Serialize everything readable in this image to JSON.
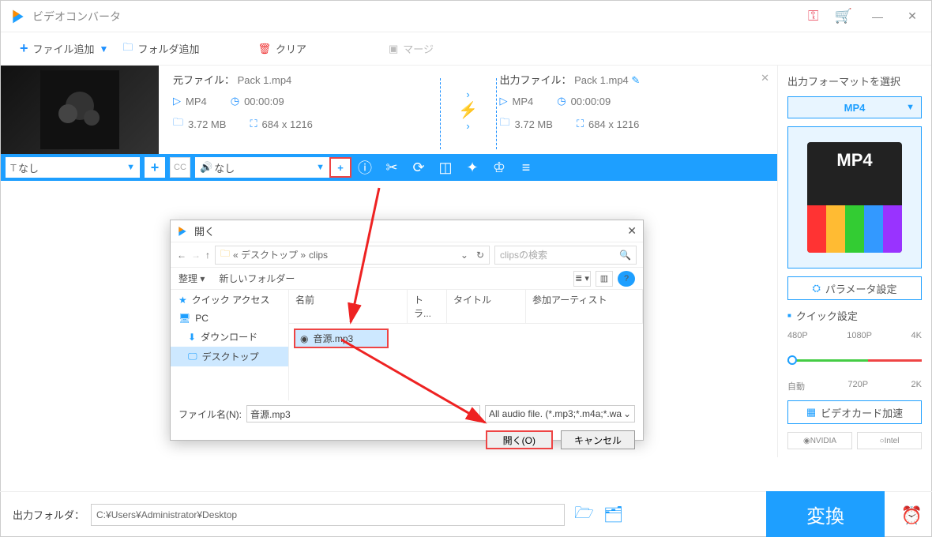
{
  "title": "ビデオコンバータ",
  "toolbar": {
    "add_file": "ファイル追加",
    "add_folder": "フォルダ追加",
    "clear": "クリア",
    "merge": "マージ"
  },
  "file": {
    "src_label": "元ファイル：",
    "src_name": "Pack 1.mp4",
    "out_label": "出力ファイル：",
    "out_name": "Pack 1.mp4",
    "format": "MP4",
    "duration": "00:00:09",
    "size": "3.72 MB",
    "dimensions": "684 x 1216"
  },
  "editbar": {
    "sub_label": "なし",
    "audio_label": "なし"
  },
  "dialog": {
    "title": "開く",
    "path_prefix": "« デスクトップ » ",
    "path_folder": "clips",
    "search_placeholder": "clipsの検索",
    "organize": "整理",
    "new_folder": "新しいフォルダー",
    "col_name": "名前",
    "col_track": "トラ...",
    "col_title": "タイトル",
    "col_artist": "参加アーティスト",
    "quick_access": "クイック アクセス",
    "pc": "PC",
    "downloads": "ダウンロード",
    "desktop": "デスクトップ",
    "selected_file": "音源.mp3",
    "filename_label": "ファイル名(N):",
    "filename_value": "音源.mp3",
    "filter": "All audio file. (*.mp3;*.m4a;*.wa",
    "open_btn": "開く(O)",
    "cancel_btn": "キャンセル"
  },
  "right": {
    "output_fmt_label": "出力フォーマットを選択",
    "format": "MP4",
    "param_btn": "パラメータ設定",
    "quick_label": "クイック設定",
    "res": {
      "r1": "480P",
      "r2": "1080P",
      "r3": "4K",
      "r4": "自動",
      "r5": "720P",
      "r6": "2K"
    },
    "gpu_btn": "ビデオカード加速",
    "nvidia": "NVIDIA",
    "intel": "Intel"
  },
  "bottom": {
    "label": "出力フォルダ：",
    "path": "C:¥Users¥Administrator¥Desktop",
    "convert": "変換"
  }
}
